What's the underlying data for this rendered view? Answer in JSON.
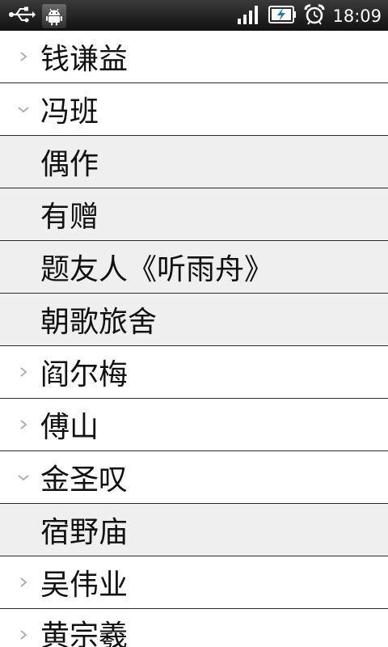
{
  "status_bar": {
    "time": "18:09",
    "icons": [
      "usb-icon",
      "android-debug-icon",
      "signal-icon",
      "battery-charging-icon",
      "alarm-icon"
    ]
  },
  "list": {
    "items": [
      {
        "label": "钱谦益",
        "kind": "group",
        "state": "collapsed"
      },
      {
        "label": "冯班",
        "kind": "group",
        "state": "expanded"
      },
      {
        "label": "偶作",
        "kind": "child"
      },
      {
        "label": "有赠",
        "kind": "child"
      },
      {
        "label": "题友人《听雨舟》",
        "kind": "child"
      },
      {
        "label": "朝歌旅舍",
        "kind": "child"
      },
      {
        "label": "阎尔梅",
        "kind": "group",
        "state": "collapsed"
      },
      {
        "label": "傅山",
        "kind": "group",
        "state": "collapsed"
      },
      {
        "label": "金圣叹",
        "kind": "group",
        "state": "expanded"
      },
      {
        "label": "宿野庙",
        "kind": "child"
      },
      {
        "label": "吴伟业",
        "kind": "group",
        "state": "collapsed"
      },
      {
        "label": "黄宗羲",
        "kind": "group",
        "state": "collapsed"
      }
    ]
  },
  "colors": {
    "status_bar": "#1e1e1e",
    "group_bg": "#ffffff",
    "child_bg": "#efefef",
    "divider": "#2a2a2a",
    "chevron": "#b0b0b0"
  }
}
